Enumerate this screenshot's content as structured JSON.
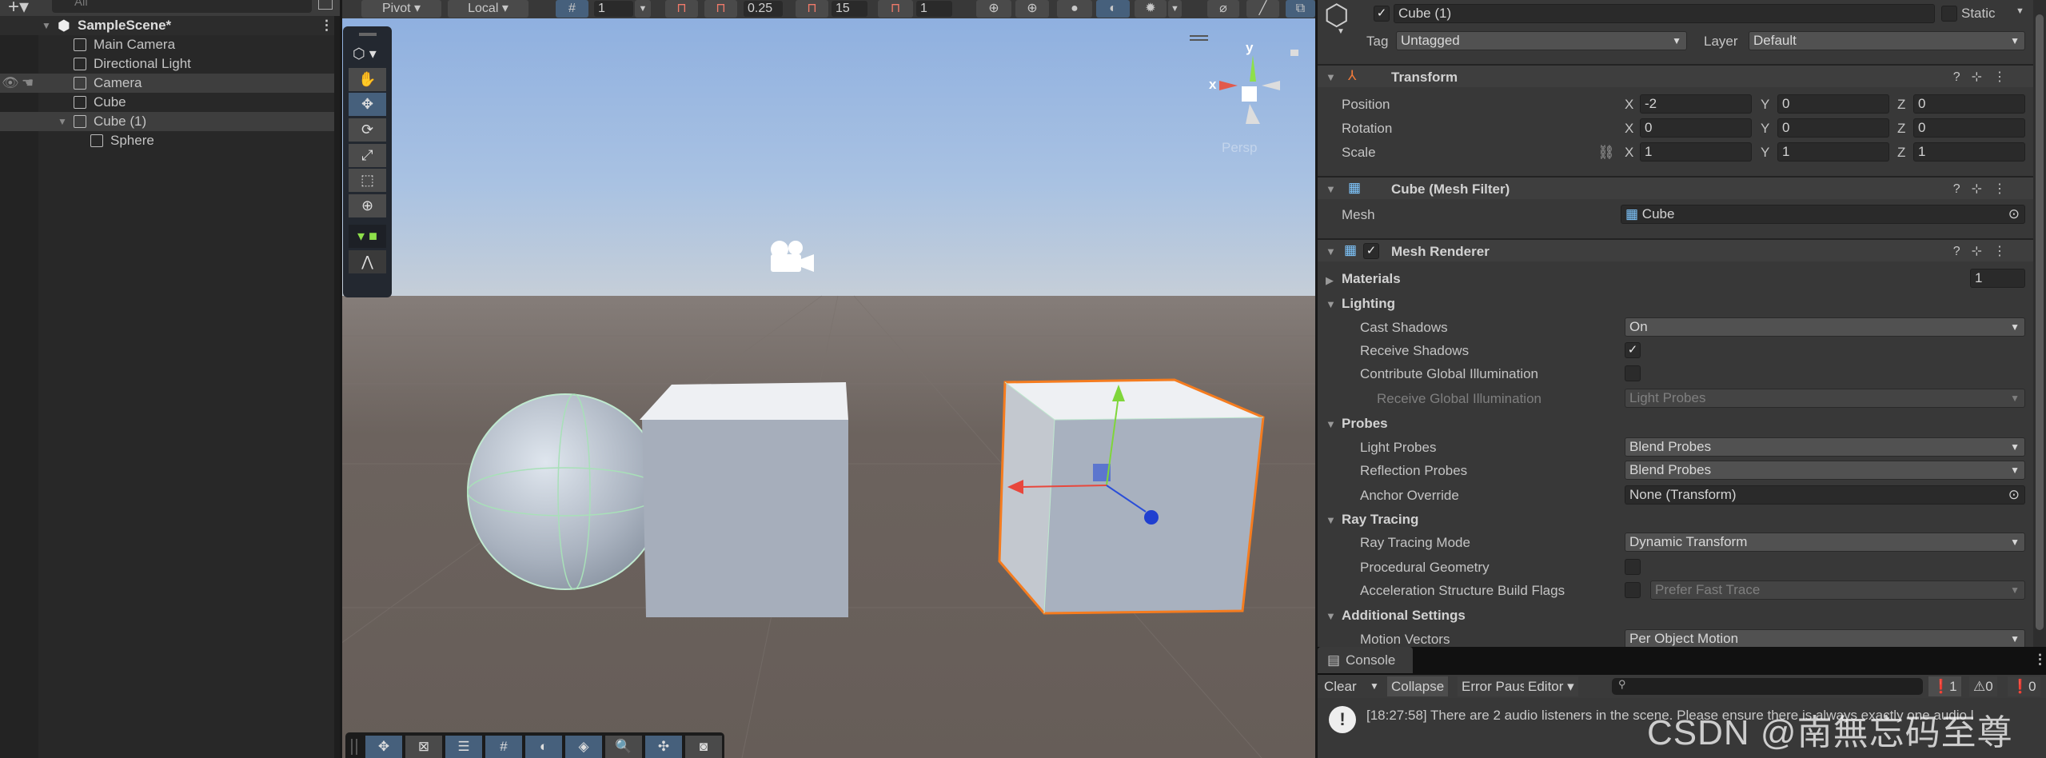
{
  "hierarchy": {
    "search_placeholder": "All",
    "scene_name": "SampleScene*",
    "items": [
      {
        "label": "Main Camera"
      },
      {
        "label": "Directional Light"
      },
      {
        "label": "Camera"
      },
      {
        "label": "Cube"
      },
      {
        "label": "Cube (1)"
      },
      {
        "label": "Sphere"
      }
    ]
  },
  "scene_toolbar": {
    "pivot": "Pivot",
    "local": "Local",
    "grid_size": "1",
    "move_snap": "0.25",
    "rotate_snap": "15",
    "scale_snap": "1"
  },
  "scene_view": {
    "gizmo_y": "y",
    "gizmo_x": "x",
    "projection": "Persp"
  },
  "inspector": {
    "object_name": "Cube (1)",
    "active": true,
    "static_label": "Static",
    "tag_label": "Tag",
    "tag_value": "Untagged",
    "layer_label": "Layer",
    "layer_value": "Default",
    "transform": {
      "title": "Transform",
      "position_label": "Position",
      "rotation_label": "Rotation",
      "scale_label": "Scale",
      "position": {
        "x": "-2",
        "y": "0",
        "z": "0"
      },
      "rotation": {
        "x": "0",
        "y": "0",
        "z": "0"
      },
      "scale": {
        "x": "1",
        "y": "1",
        "z": "1"
      }
    },
    "mesh_filter": {
      "title": "Cube (Mesh Filter)",
      "mesh_label": "Mesh",
      "mesh_value": "Cube"
    },
    "mesh_renderer": {
      "title": "Mesh Renderer",
      "materials_label": "Materials",
      "materials_count": "1",
      "lighting": "Lighting",
      "cast_shadows_label": "Cast Shadows",
      "cast_shadows": "On",
      "receive_shadows_label": "Receive Shadows",
      "receive_shadows": true,
      "contribute_gi_label": "Contribute Global Illumination",
      "contribute_gi": false,
      "receive_gi_label": "Receive Global Illumination",
      "receive_gi": "Light Probes",
      "probes": "Probes",
      "light_probes_label": "Light Probes",
      "light_probes": "Blend Probes",
      "reflection_probes_label": "Reflection Probes",
      "reflection_probes": "Blend Probes",
      "anchor_override_label": "Anchor Override",
      "anchor_override": "None (Transform)",
      "ray_tracing": "Ray Tracing",
      "ray_tracing_mode_label": "Ray Tracing Mode",
      "ray_tracing_mode": "Dynamic Transform",
      "procedural_geometry_label": "Procedural Geometry",
      "accel_flags_label": "Acceleration Structure Build Flags",
      "accel_flags": "Prefer Fast Trace",
      "additional_settings": "Additional Settings",
      "motion_vectors_label": "Motion Vectors",
      "motion_vectors": "Per Object Motion"
    }
  },
  "console": {
    "tab": "Console",
    "clear": "Clear",
    "collapse": "Collapse",
    "error_pause": "Error Pause",
    "editor": "Editor",
    "log_count": "1",
    "warning_count": "0",
    "error_count": "0",
    "message": "[18:27:58] There are 2 audio listeners in the scene. Please ensure there is always exactly one audio l"
  },
  "watermark": "CSDN @南無忘码至尊",
  "colors": {
    "selection_orange": "#f57c1f",
    "axis_x": "#e8473c",
    "axis_y": "#7fd63a",
    "axis_z": "#2a4ed8",
    "active_button": "#46607c"
  }
}
